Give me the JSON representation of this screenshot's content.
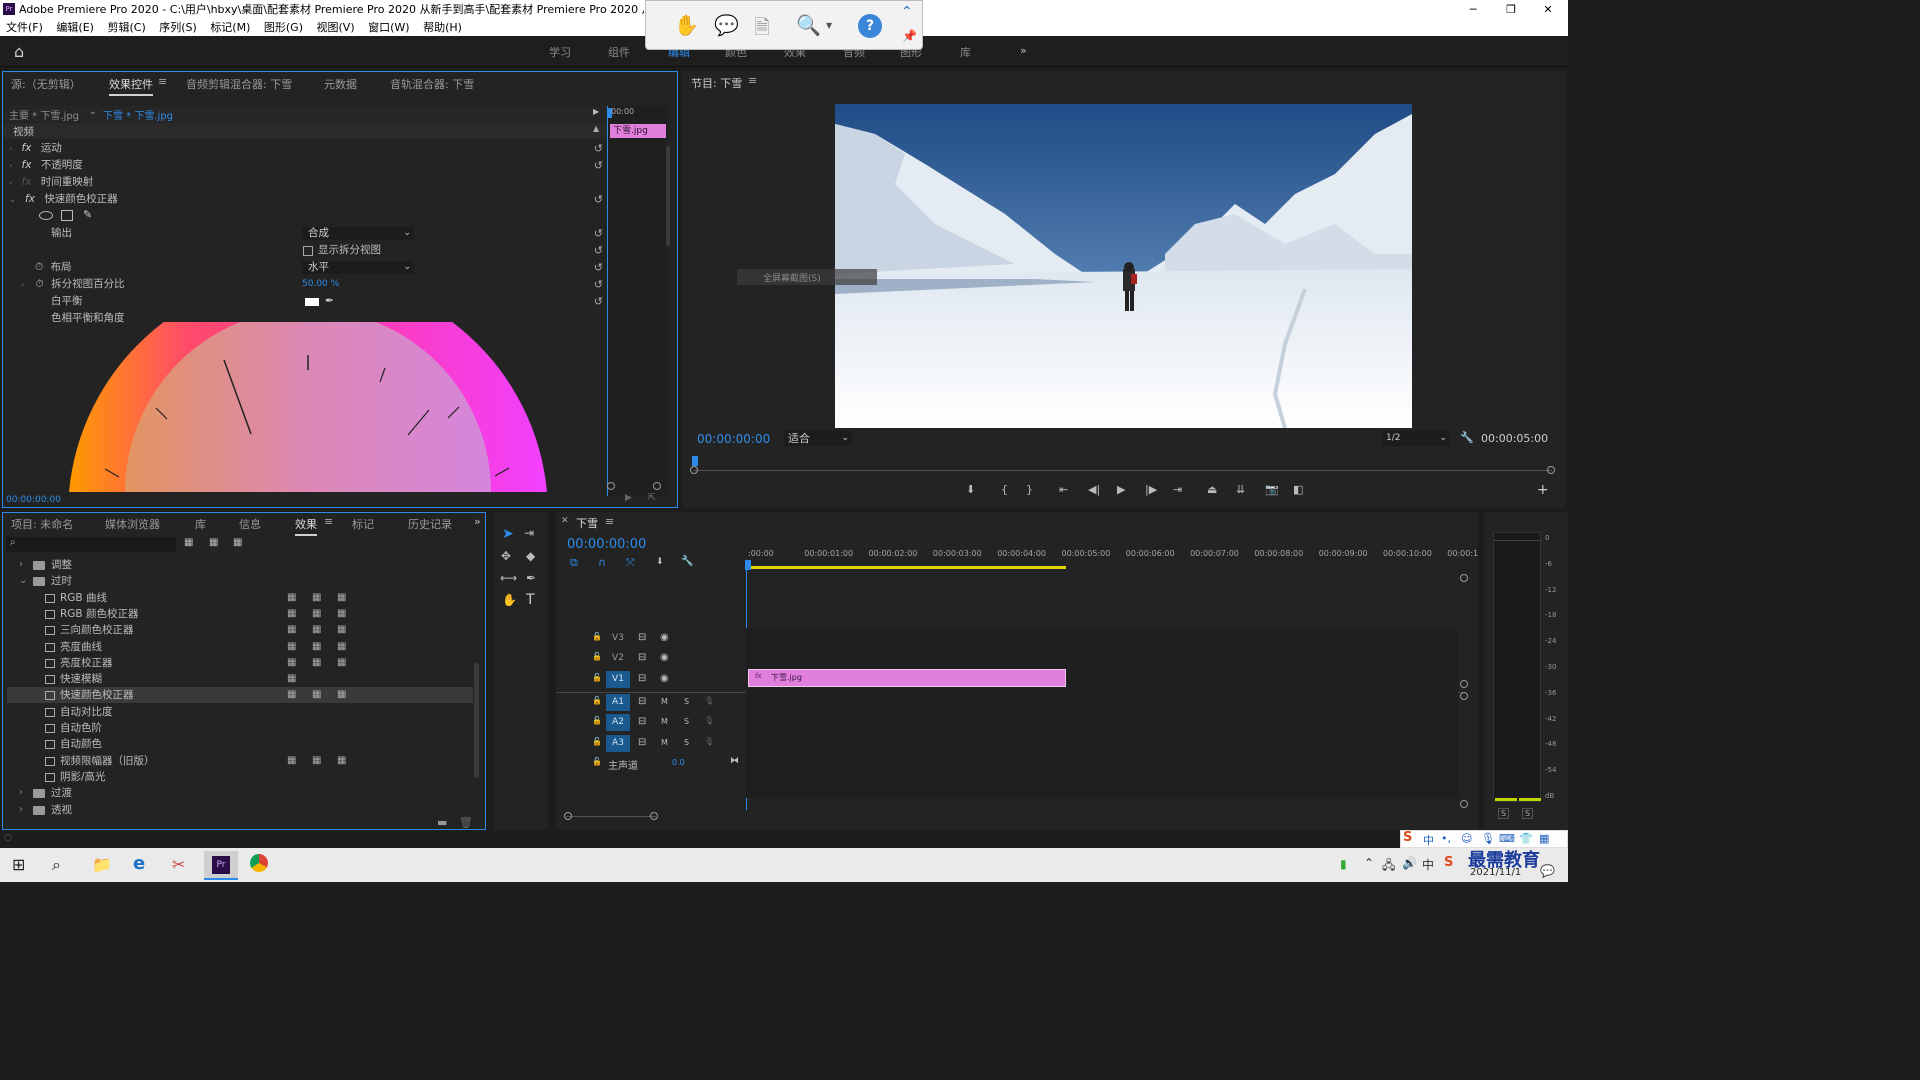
{
  "app": {
    "title": "Adobe Premiere Pro 2020 - C:\\用户\\hbxy\\桌面\\配套素材 Premiere Pro 2020 从新手到高手\\配套素材 Premiere Pro 2020 从新手到高手\\第",
    "logo_label": "Pr"
  },
  "menu": [
    "文件(F)",
    "编辑(E)",
    "剪辑(C)",
    "序列(S)",
    "标记(M)",
    "图形(G)",
    "视图(V)",
    "窗口(W)",
    "帮助(H)"
  ],
  "workspaces": [
    "学习",
    "组件",
    "编辑",
    "颜色",
    "效果",
    "音频",
    "图形",
    "库"
  ],
  "effects_panel": {
    "tabs": [
      "源:（无剪辑）",
      "效果控件",
      "音频剪辑混合器: 下雪",
      "元数据",
      "音轨混合器: 下雪"
    ],
    "master_label": "主要 * 下雪.jpg",
    "clip_label": "下雪 * 下雪.jpg",
    "timecode_start": "00:00",
    "clip_chip": "下雪.jpg",
    "section_video": "视频",
    "effects": [
      "运动",
      "不透明度",
      "时间重映射",
      "快速颜色校正器"
    ],
    "params": {
      "output_label": "输出",
      "output_value": "合成",
      "split_view_label": "显示拆分视图",
      "layout_label": "布局",
      "layout_value": "水平",
      "split_percent_label": "拆分视图百分比",
      "split_percent_value": "50.00 %",
      "white_balance_label": "白平衡",
      "hue_balance_label": "色相平衡和角度"
    },
    "bottom_timecode": "00:00:00:00"
  },
  "program_monitor": {
    "title": "节目: 下雪",
    "overlay_hint": "全屏幕截图(S)",
    "current_tc": "00:00:00:00",
    "zoom": "适合",
    "resolution": "1/2",
    "duration_tc": "00:00:05:00"
  },
  "project_panel": {
    "tabs": [
      "项目: 未命名",
      "媒体浏览器",
      "库",
      "信息",
      "效果",
      "标记",
      "历史记录"
    ],
    "tree": [
      {
        "label": "调整",
        "type": "folder",
        "indent": 0,
        "expanded": false
      },
      {
        "label": "过时",
        "type": "folder",
        "indent": 0,
        "expanded": true
      },
      {
        "label": "RGB 曲线",
        "type": "fx",
        "indent": 1,
        "badges": 3
      },
      {
        "label": "RGB 颜色校正器",
        "type": "fx",
        "indent": 1,
        "badges": 3
      },
      {
        "label": "三向颜色校正器",
        "type": "fx",
        "indent": 1,
        "badges": 3
      },
      {
        "label": "亮度曲线",
        "type": "fx",
        "indent": 1,
        "badges": 3
      },
      {
        "label": "亮度校正器",
        "type": "fx",
        "indent": 1,
        "badges": 3
      },
      {
        "label": "快速模糊",
        "type": "fx",
        "indent": 1,
        "badges": 1
      },
      {
        "label": "快速颜色校正器",
        "type": "fx",
        "indent": 1,
        "badges": 3,
        "selected": true
      },
      {
        "label": "自动对比度",
        "type": "fx",
        "indent": 1,
        "badges": 0
      },
      {
        "label": "自动色阶",
        "type": "fx",
        "indent": 1,
        "badges": 0
      },
      {
        "label": "自动颜色",
        "type": "fx",
        "indent": 1,
        "badges": 0
      },
      {
        "label": "视频限幅器（旧版）",
        "type": "fx",
        "indent": 1,
        "badges": 3
      },
      {
        "label": "阴影/高光",
        "type": "fx",
        "indent": 1,
        "badges": 0
      },
      {
        "label": "过渡",
        "type": "folder",
        "indent": 0,
        "expanded": false
      },
      {
        "label": "透视",
        "type": "folder",
        "indent": 0,
        "expanded": false
      }
    ]
  },
  "timeline": {
    "title": "下雪",
    "timecode": "00:00:00:00",
    "ruler": [
      ":00:00",
      "00:00:01:00",
      "00:00:02:00",
      "00:00:03:00",
      "00:00:04:00",
      "00:00:05:00",
      "00:00:06:00",
      "00:00:07:00",
      "00:00:08:00",
      "00:00:09:00",
      "00:00:10:00",
      "00:00:1"
    ],
    "video_tracks": [
      "V3",
      "V2",
      "V1"
    ],
    "audio_tracks": [
      "A1",
      "A2",
      "A3"
    ],
    "source_patch_video": "V1",
    "master_label": "主声道",
    "master_value": "0.0",
    "clip_name": "下雪.jpg",
    "mute_label": "M",
    "solo_label": "S"
  },
  "audio_meter": {
    "scale": [
      "0",
      "-6",
      "-12",
      "-18",
      "-24",
      "-30",
      "-36",
      "-42",
      "-48",
      "-54",
      "dB"
    ],
    "solo_buttons": [
      "S",
      "S"
    ]
  },
  "taskbar": {
    "date": "2021/11/1",
    "watermark": "最需教育",
    "ime_label": "中"
  },
  "colors": {
    "accent_blue": "#2d8ceb",
    "clip_pink": "#e07fdc",
    "track_blue": "#1b5a8e",
    "work_area_yellow": "#e3d600"
  }
}
